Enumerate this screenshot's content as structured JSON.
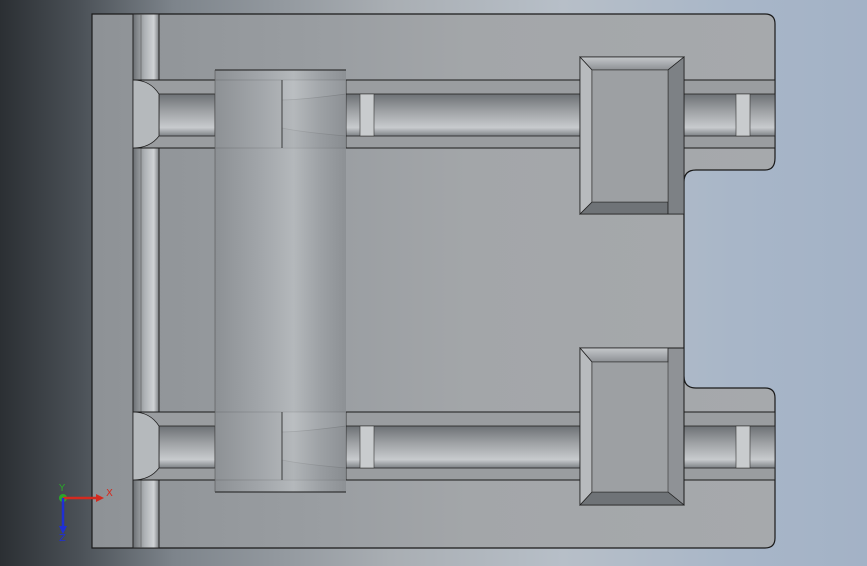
{
  "view": {
    "type": "CAD model viewport",
    "description_visible": false
  },
  "triad": {
    "x_label": "X",
    "y_label": "Y",
    "z_label": "Z",
    "x_color": "#d42a1f",
    "y_color": "#2aa52a",
    "z_color": "#1f2fd4"
  },
  "colors": {
    "part_face": "#9fa2a5",
    "edge": "#1a1a1a",
    "highlight": "#cfd3d6",
    "shadow": "#6f7377"
  }
}
